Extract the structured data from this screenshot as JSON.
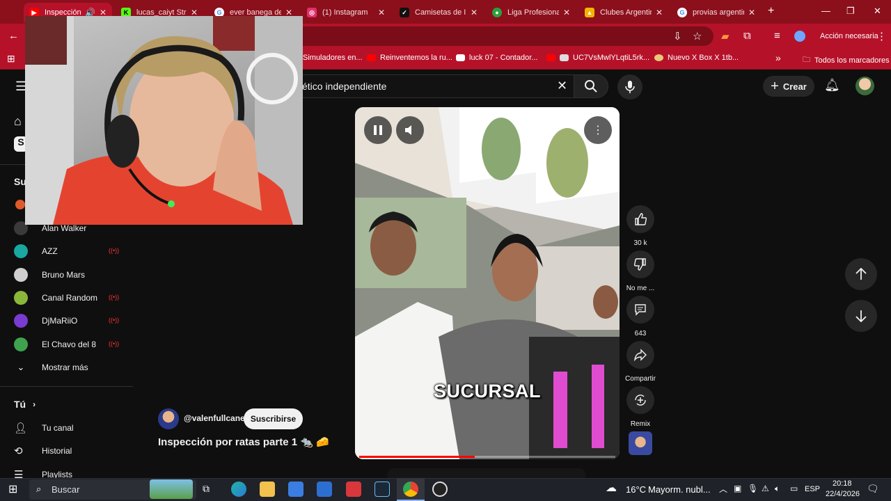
{
  "browser": {
    "tabs": [
      {
        "title": "Inspección p",
        "active": true,
        "favicon": "youtube-icon",
        "color": "#ff0000"
      },
      {
        "title": "lucas_caiyt Strea",
        "favicon": "kick-icon",
        "color": "#53fc18"
      },
      {
        "title": "ever banega def",
        "favicon": "google-icon",
        "color": "#4285f4"
      },
      {
        "title": "(1) Instagram",
        "favicon": "instagram-icon",
        "color": "#e1306c"
      },
      {
        "title": "Camisetas de Ind",
        "favicon": "nike-icon",
        "color": "#111111"
      },
      {
        "title": "Liga Profesional",
        "favicon": "liga-icon",
        "color": "#2e9e3e"
      },
      {
        "title": "Clubes Argentin",
        "favicon": "drive-icon",
        "color": "#f4b400"
      },
      {
        "title": "provias argentin",
        "favicon": "google-icon",
        "color": "#4285f4"
      }
    ],
    "new_tab": "+",
    "accion": "Acción necesaria",
    "bookmarks": [
      "Simuladores en...",
      "Reinventemos la ru...",
      "luck 07 - Contador...",
      "UC7VsMwlYLqtiL5rk...",
      "Nuevo X Box X 1tb..."
    ],
    "bookmarks_more": "»",
    "all_bookmarks": "Todos los marcadores"
  },
  "youtube": {
    "search_query": "ético independiente",
    "create_label": "Crear",
    "sidebar": {
      "subs_heading_partial": "Su",
      "subscriptions": [
        {
          "name": "Alan Walker",
          "live": false,
          "color": "#3a3a3a"
        },
        {
          "name": "AZZ",
          "live": true,
          "color": "#1aa7a0"
        },
        {
          "name": "Bruno Mars",
          "live": false,
          "color": "#cfcfcf"
        },
        {
          "name": "Canal Random",
          "live": true,
          "color": "#8ab63a"
        },
        {
          "name": "DjMaRiiO",
          "live": true,
          "color": "#7a3bd0"
        },
        {
          "name": "El Chavo del 8",
          "live": true,
          "color": "#3fa34d"
        }
      ],
      "show_more": "Mostrar más",
      "you_heading": "Tú",
      "you_items": [
        "Tu canal",
        "Historial",
        "Playlists"
      ]
    },
    "short": {
      "caption": "SUCURSAL",
      "progress": 0.45,
      "channel": "@valenfullcane",
      "subscribe_label": "Suscribirse",
      "title": "Inspección por ratas parte 1 🐀 🧀"
    },
    "actions": {
      "likes": "30 k",
      "dislike": "No me ...",
      "comments": "643",
      "share": "Compartir",
      "remix": "Remix"
    }
  },
  "taskbar": {
    "search_placeholder": "Buscar",
    "weather_temp": "16°C",
    "weather_desc": "Mayorm. nubl...",
    "lang": "ESP",
    "time": "20:18",
    "date": "22/4/2026"
  }
}
